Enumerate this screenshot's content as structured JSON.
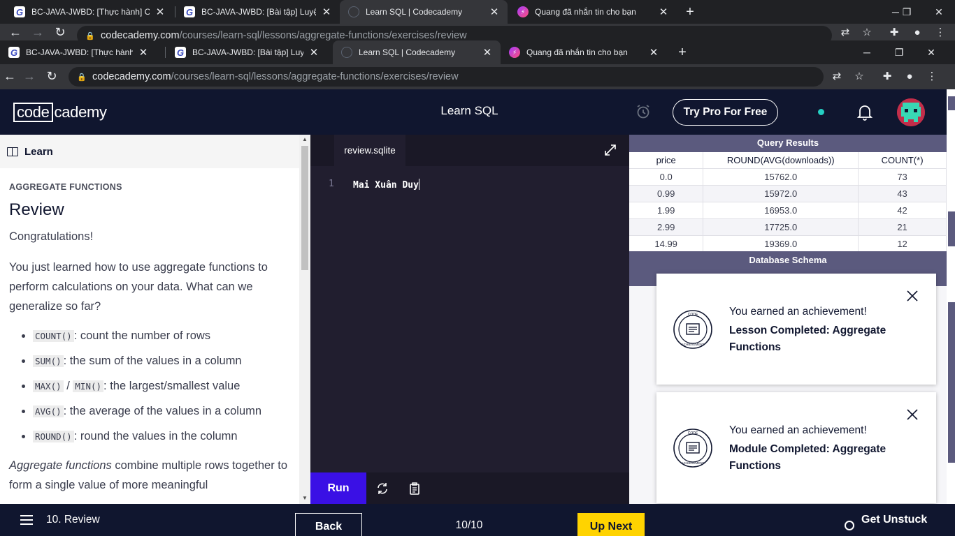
{
  "browser_outer": {
    "tabs": [
      {
        "title": "BC-JAVA-JWBD: [Thực hành] Các"
      },
      {
        "title": "BC-JAVA-JWBD: [Bài tập] Luyện t"
      },
      {
        "title": "Learn SQL | Codecademy"
      },
      {
        "title": "Quang đã nhắn tin cho bạn"
      }
    ],
    "url_host": "codecademy.com",
    "url_path": "/courses/learn-sql/lessons/aggregate-functions/exercises/review"
  },
  "browser_inner": {
    "tabs": [
      {
        "title": "BC-JAVA-JWBD: [Thực hành] Các"
      },
      {
        "title": "BC-JAVA-JWBD: [Bài tập] Luyện t"
      },
      {
        "title": "Learn SQL | Codecademy"
      },
      {
        "title": "Quang đã nhắn tin cho bạn"
      }
    ],
    "url_host": "codecademy.com",
    "url_path": "/courses/learn-sql/lessons/aggregate-functions/exercises/review"
  },
  "header": {
    "logo_box": "code",
    "logo_rest": "cademy",
    "course_title": "Learn SQL",
    "try_pro": "Try Pro For Free"
  },
  "learn": {
    "tab_label": "Learn",
    "eyebrow": "AGGREGATE FUNCTIONS",
    "title": "Review",
    "congrats": "Congratulations!",
    "intro": "You just learned how to use aggregate functions to perform calculations on your data. What can we generalize so far?",
    "bullets": [
      {
        "code": "COUNT()",
        "text": ": count the number of rows"
      },
      {
        "code": "SUM()",
        "text": ": the sum of the values in a column"
      },
      {
        "code": "MAX()",
        "sep": " / ",
        "code2": "MIN()",
        "text": ": the largest/smallest value"
      },
      {
        "code": "AVG()",
        "text": ": the average of the values in a column"
      },
      {
        "code": "ROUND()",
        "text": ": round the values in the column"
      }
    ],
    "outro_em": "Aggregate functions",
    "outro": " combine multiple rows together to form a single value of more meaningful"
  },
  "editor": {
    "file_tab": "review.sqlite",
    "line_number": "1",
    "code": "Mai Xuân Duy",
    "run_label": "Run"
  },
  "results": {
    "title": "Query Results",
    "columns": [
      "price",
      "ROUND(AVG(downloads))",
      "COUNT(*)"
    ],
    "rows": [
      [
        "0.0",
        "15762.0",
        "73"
      ],
      [
        "0.99",
        "15972.0",
        "43"
      ],
      [
        "1.99",
        "16953.0",
        "42"
      ],
      [
        "2.99",
        "17725.0",
        "21"
      ],
      [
        "14.99",
        "19369.0",
        "12"
      ]
    ],
    "schema_title": "Database Schema"
  },
  "toasts": [
    {
      "earned": "You earned an achievement!",
      "what": "Lesson Completed: Aggregate Functions"
    },
    {
      "earned": "You earned an achievement!",
      "what": "Module Completed: Aggregate Functions"
    }
  ],
  "badge_text": {
    "top": "CODE",
    "bottom": "ACHIEVEMENT"
  },
  "footer": {
    "lesson": "10. Review",
    "back": "Back",
    "pager": "10/10",
    "up_next": "Up Next",
    "get_unstuck": "Get Unstuck"
  },
  "colors": {
    "header_bg": "#10162f",
    "run_btn": "#3a10e5",
    "up_next": "#ffd300",
    "panel_head": "#5b5a7e"
  }
}
